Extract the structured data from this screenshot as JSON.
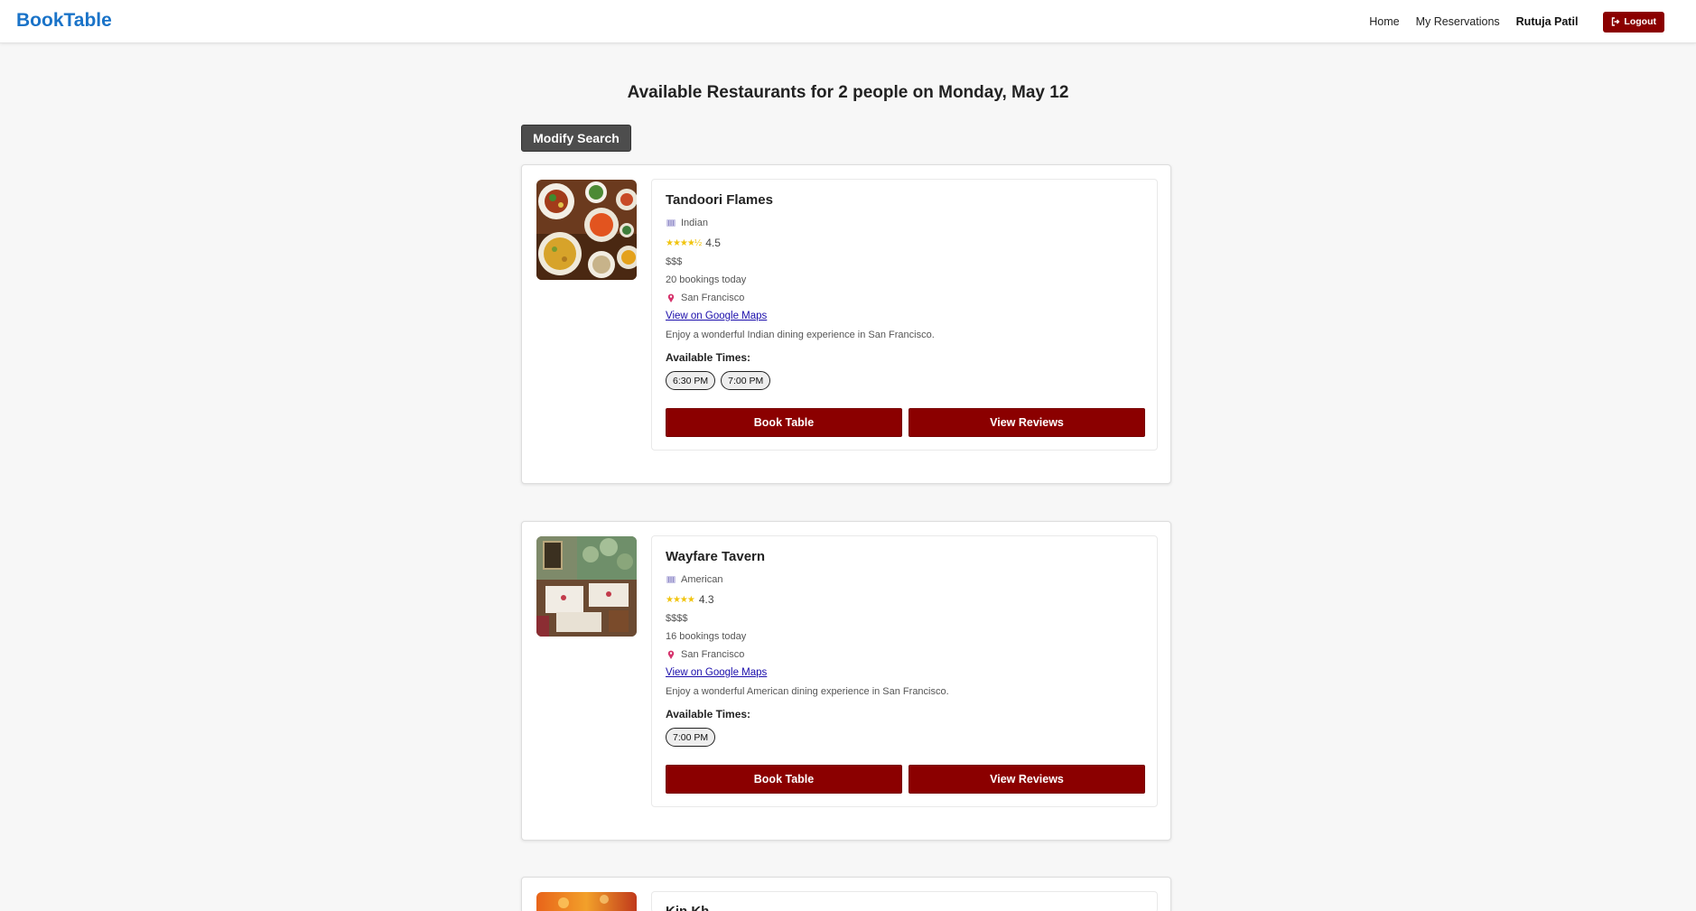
{
  "nav": {
    "brand": "BookTable",
    "links": [
      "Home",
      "My Reservations"
    ],
    "user": "Rutuja Patil",
    "logout": "Logout"
  },
  "page": {
    "title": "Available Restaurants for 2 people on Monday, May 12",
    "modify_search": "Modify Search",
    "available_times_label": "Available Times:",
    "book_label": "Book Table",
    "reviews_label": "View Reviews",
    "maps_label": "View on Google Maps"
  },
  "restaurants": [
    {
      "name": "Tandoori Flames",
      "cuisine": "Indian",
      "stars": "★★★★½",
      "rating": "4.5",
      "price": "$$$",
      "bookings": "20 bookings today",
      "location": "San Francisco",
      "description": "Enjoy a wonderful Indian dining experience in San Francisco.",
      "times": [
        "6:30 PM",
        "7:00 PM"
      ]
    },
    {
      "name": "Wayfare Tavern",
      "cuisine": "American",
      "stars": "★★★★",
      "rating": "4.3",
      "price": "$$$$",
      "bookings": "16 bookings today",
      "location": "San Francisco",
      "description": "Enjoy a wonderful American dining experience in San Francisco.",
      "times": [
        "7:00 PM"
      ]
    },
    {
      "name": "Kin Kh"
    }
  ],
  "colors": {
    "brand": "#1a73c8",
    "primary_button": "#8b0000",
    "modify_button": "#4d4d4d",
    "link": "#1a0dab"
  }
}
